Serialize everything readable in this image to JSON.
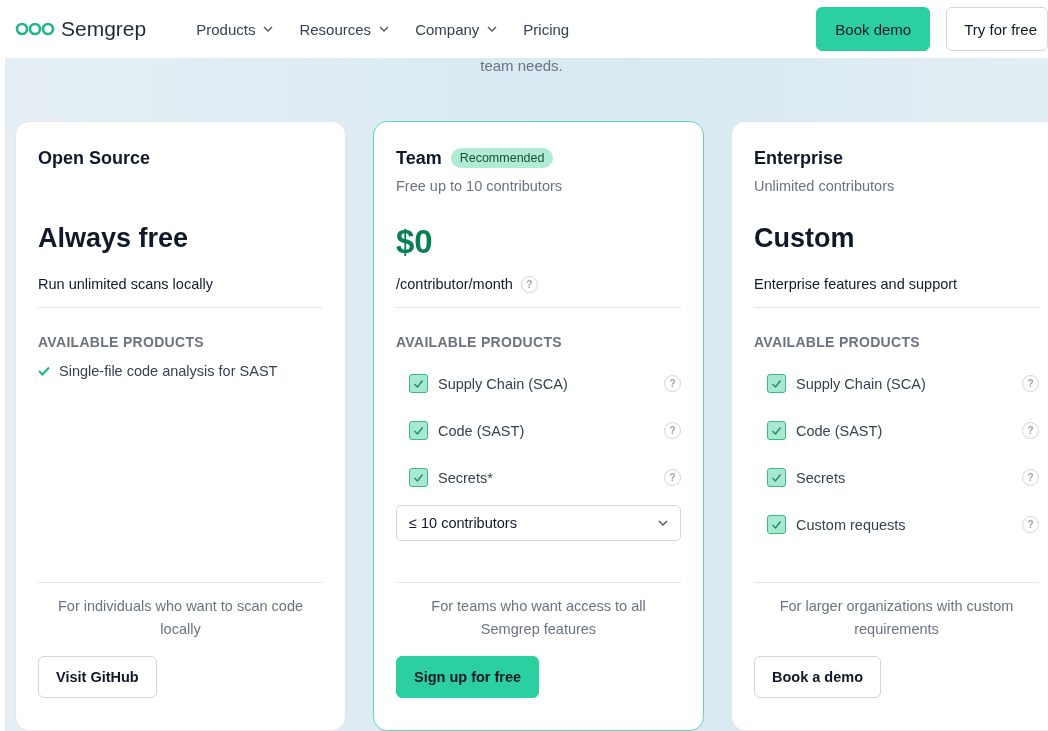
{
  "header": {
    "logo": "Semgrep",
    "nav": [
      {
        "label": "Products",
        "dropdown": true
      },
      {
        "label": "Resources",
        "dropdown": true
      },
      {
        "label": "Company",
        "dropdown": true
      },
      {
        "label": "Pricing",
        "dropdown": false
      }
    ],
    "buttons": [
      {
        "label": "Book demo",
        "kind": "primary"
      },
      {
        "label": "Try for free",
        "kind": "secondary"
      }
    ]
  },
  "intro": "team needs.",
  "plans": [
    {
      "name": "Open Source",
      "highlighted": false,
      "price": "Always free",
      "caption": "Run unlimited scans locally",
      "products_heading": "AVAILABLE PRODUCTS",
      "products": [
        {
          "kind": "tick",
          "label": "Single-file code analysis for SAST"
        }
      ],
      "description": "For individuals who want to scan code locally",
      "cta": {
        "label": "Visit GitHub",
        "kind": "secondary"
      }
    },
    {
      "name": "Team",
      "badge": "Recommended",
      "highlighted": true,
      "subtitle": "Free up to 10 contributors",
      "price": "$0",
      "caption": "/contributor/month",
      "caption_help": "?",
      "products_heading": "AVAILABLE PRODUCTS",
      "products": [
        {
          "kind": "checkbox",
          "label": "Supply Chain (SCA)",
          "checked": true,
          "help": "?"
        },
        {
          "kind": "checkbox",
          "label": "Code (SAST)",
          "checked": true,
          "help": "?"
        },
        {
          "kind": "checkbox",
          "label": "Secrets*",
          "checked": true,
          "help": "?"
        }
      ],
      "select": {
        "value": "≤ 10 contributors"
      },
      "description": "For teams who want access to all Semgrep features",
      "cta": {
        "label": "Sign up for free",
        "kind": "primary"
      }
    },
    {
      "name": "Enterprise",
      "highlighted": false,
      "subtitle": "Unlimited contributors",
      "price": "Custom",
      "caption": "Enterprise features and support",
      "products_heading": "AVAILABLE PRODUCTS",
      "products": [
        {
          "kind": "checkbox",
          "label": "Supply Chain (SCA)",
          "checked": true,
          "help": "?"
        },
        {
          "kind": "checkbox",
          "label": "Code (SAST)",
          "checked": true,
          "help": "?"
        },
        {
          "kind": "checkbox",
          "label": "Secrets",
          "checked": true,
          "help": "?"
        },
        {
          "kind": "checkbox",
          "label": "Custom requests",
          "checked": true,
          "help": "?"
        }
      ],
      "description": "For larger organizations with custom requirements",
      "cta": {
        "label": "Book a demo",
        "kind": "secondary"
      }
    }
  ]
}
